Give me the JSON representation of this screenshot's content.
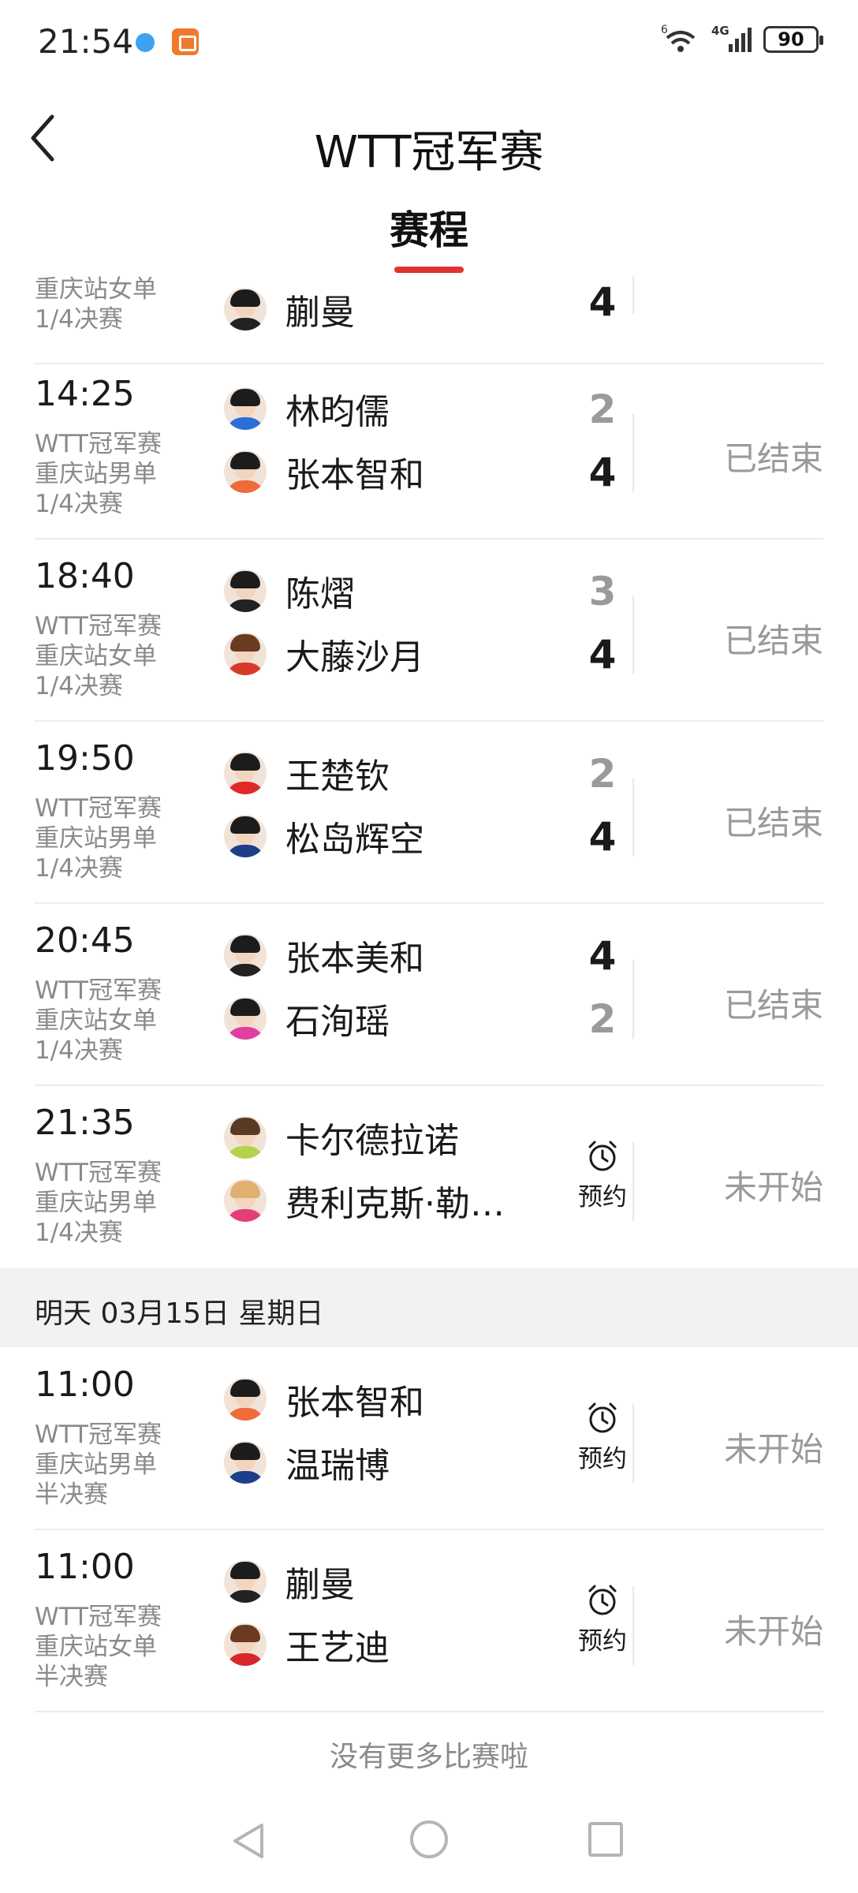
{
  "statusbar": {
    "time": "21:54",
    "network": "4G",
    "signal_prefix": "6",
    "battery": "90"
  },
  "header": {
    "title": "WTT冠军赛",
    "tab": "赛程"
  },
  "partial_top": {
    "sub2": "重庆站女单",
    "sub3": "1/4决赛",
    "player": "蒯曼",
    "score": "4"
  },
  "matches": [
    {
      "time": "14:25",
      "event": "WTT冠军赛",
      "station": "重庆站男单",
      "round": "1/4决赛",
      "p1": "林昀儒",
      "s1": "2",
      "p2": "张本智和",
      "s2": "4",
      "status": "已结束"
    },
    {
      "time": "18:40",
      "event": "WTT冠军赛",
      "station": "重庆站女单",
      "round": "1/4决赛",
      "p1": "陈熠",
      "s1": "3",
      "p2": "大藤沙月",
      "s2": "4",
      "status": "已结束"
    },
    {
      "time": "19:50",
      "event": "WTT冠军赛",
      "station": "重庆站男单",
      "round": "1/4决赛",
      "p1": "王楚钦",
      "s1": "2",
      "p2": "松岛辉空",
      "s2": "4",
      "status": "已结束"
    },
    {
      "time": "20:45",
      "event": "WTT冠军赛",
      "station": "重庆站女单",
      "round": "1/4决赛",
      "p1": "张本美和",
      "s1": "4",
      "p2": "石洵瑶",
      "s2": "2",
      "status": "已结束"
    },
    {
      "time": "21:35",
      "event": "WTT冠军赛",
      "station": "重庆站男单",
      "round": "1/4决赛",
      "p1": "卡尔德拉诺",
      "p2": "费利克斯·勒…",
      "remind": "预约",
      "status": "未开始"
    }
  ],
  "date_divider": "明天 03月15日 星期日",
  "matches_tomorrow": [
    {
      "time": "11:00",
      "event": "WTT冠军赛",
      "station": "重庆站男单",
      "round": "半决赛",
      "p1": "张本智和",
      "p2": "温瑞博",
      "remind": "预约",
      "status": "未开始"
    },
    {
      "time": "11:00",
      "event": "WTT冠军赛",
      "station": "重庆站女单",
      "round": "半决赛",
      "p1": "蒯曼",
      "p2": "王艺迪",
      "remind": "预约",
      "status": "未开始"
    }
  ],
  "footer": {
    "no_more": "没有更多比赛啦"
  },
  "colors": {
    "accent": "#e03232",
    "muted": "#9a9a9a",
    "divider_bg": "#f1f2f4"
  }
}
